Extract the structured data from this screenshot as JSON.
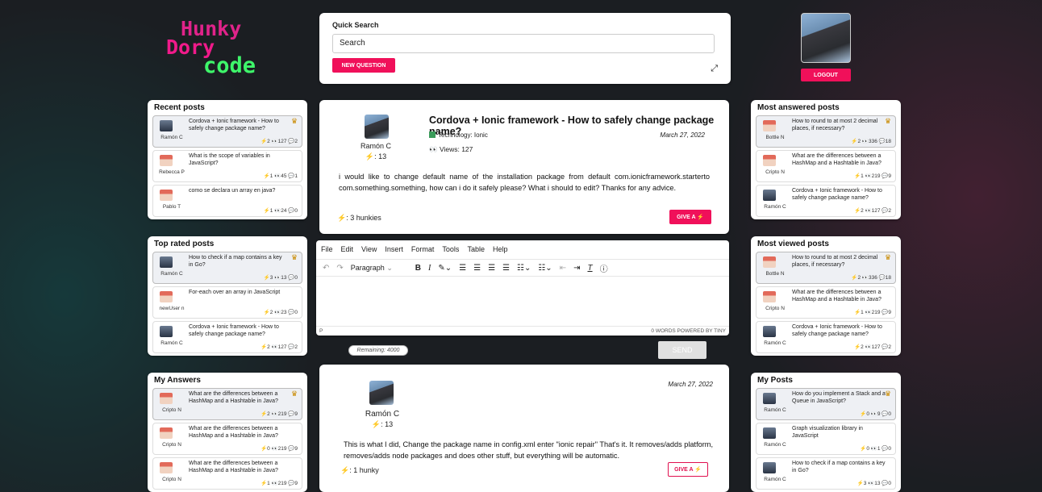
{
  "colors": {
    "accent": "#f0105a",
    "logo_pink": "#e0238a",
    "logo_green": "#3ef56a"
  },
  "logo": {
    "line1": "Hunky",
    "line2": "Dory",
    "line3": "code"
  },
  "quick_search": {
    "label": "Quick Search",
    "value": "Search",
    "new_question": "NEW QUESTION",
    "expand_icon": "expand-icon"
  },
  "user": {
    "logout": "LOGOUT"
  },
  "recent_posts": {
    "title": "Recent posts",
    "items": [
      {
        "author": "Ramón C",
        "title": "Cordova + Ionic framework - How to safely change package name?",
        "stats": "⚡2 👀127 💬2",
        "crown": true
      },
      {
        "author": "Rebecca P",
        "title": "What is the scope of variables in JavaScript?",
        "stats": "⚡1 👀45 💬1",
        "crown": false
      },
      {
        "author": "Pablo T",
        "title": "como se declara un array en java?",
        "stats": "⚡1 👀24 💬0",
        "crown": false
      }
    ]
  },
  "top_rated": {
    "title": "Top rated posts",
    "items": [
      {
        "author": "Ramón C",
        "title": "How to check if a map contains a key in Go?",
        "stats": "⚡3 👀13 💬0",
        "crown": true
      },
      {
        "author": "newUser n",
        "title": "For-each over an array in JavaScript",
        "stats": "⚡2 👀23 💬0",
        "crown": false
      },
      {
        "author": "Ramón C",
        "title": "Cordova + Ionic framework - How to safely change package name?",
        "stats": "⚡2 👀127 💬2",
        "crown": false
      }
    ]
  },
  "my_answers": {
    "title": "My Answers",
    "items": [
      {
        "author": "Cripto N",
        "title": "What are the differences between a HashMap and a Hashtable in Java?",
        "stats": "⚡2 👀219 💬9",
        "crown": true
      },
      {
        "author": "Cripto N",
        "title": "What are the differences between a HashMap and a Hashtable in Java?",
        "stats": "⚡0 👀219 💬9",
        "crown": false
      },
      {
        "author": "Cripto N",
        "title": "What are the differences between a HashMap and a Hashtable in Java?",
        "stats": "⚡1 👀219 💬9",
        "crown": false
      }
    ]
  },
  "most_answered": {
    "title": "Most answered posts",
    "items": [
      {
        "author": "Bottle N",
        "title": "How to round to at most 2 decimal places, if necessary?",
        "stats": "⚡2 👀336 💬18",
        "crown": true
      },
      {
        "author": "Cripto N",
        "title": "What are the differences between a HashMap and a Hashtable in Java?",
        "stats": "⚡1 👀219 💬9",
        "crown": false
      },
      {
        "author": "Ramón C",
        "title": "Cordova + Ionic framework - How to safely change package name?",
        "stats": "⚡2 👀127 💬2",
        "crown": false
      }
    ]
  },
  "most_viewed": {
    "title": "Most viewed posts",
    "items": [
      {
        "author": "Bottle N",
        "title": "How to round to at most 2 decimal places, if necessary?",
        "stats": "⚡2 👀336 💬18",
        "crown": true
      },
      {
        "author": "Cripto N",
        "title": "What are the differences between a HashMap and a Hashtable in Java?",
        "stats": "⚡1 👀219 💬9",
        "crown": false
      },
      {
        "author": "Ramón C",
        "title": "Cordova + Ionic framework - How to safely change package name?",
        "stats": "⚡2 👀127 💬2",
        "crown": false
      }
    ]
  },
  "my_posts": {
    "title": "My Posts",
    "items": [
      {
        "author": "Ramón C",
        "title": "How do you implement a Stack and a Queue in JavaScript?",
        "stats": "⚡0 👀9 💬0",
        "crown": true
      },
      {
        "author": "Ramón C",
        "title": "Graph visualization library in JavaScript",
        "stats": "⚡0 👀1 💬0",
        "crown": false
      },
      {
        "author": "Ramón C",
        "title": "How to check if a map contains a key in Go?",
        "stats": "⚡3 👀13 💬0",
        "crown": false
      }
    ]
  },
  "question": {
    "author": "Ramón C",
    "score": "⚡: 13",
    "title": "Cordova + Ionic framework - How to safely change package name?",
    "technology": "Technology: Ionic",
    "views": "Views: 127",
    "date": "March 27, 2022",
    "body": "i would like to change default name of the installation package from default com.ionicframework.starterto com.something.something, how can i do it safely please? What i should to edit? Thanks for any advice.",
    "hunkies": "⚡: 3 hunkies",
    "give": "GIVE A ⚡"
  },
  "editor": {
    "menu": [
      "File",
      "Edit",
      "View",
      "Insert",
      "Format",
      "Tools",
      "Table",
      "Help"
    ],
    "block_format": "Paragraph",
    "status_left": "P",
    "status_right": "0 WORDS  POWERED BY TINY",
    "remaining": "Remaining: 4000",
    "send": "SEND"
  },
  "answer": {
    "author": "Ramón C",
    "score": "⚡: 13",
    "date": "March 27, 2022",
    "body": "This is what I did, Change the package name in config.xml enter \"ionic repair\" That's it. It removes/adds platform, removes/adds node packages and does other stuff, but everything will be automatic.",
    "hunkies": "⚡: 1 hunky",
    "give": "GIVE A ⚡"
  }
}
